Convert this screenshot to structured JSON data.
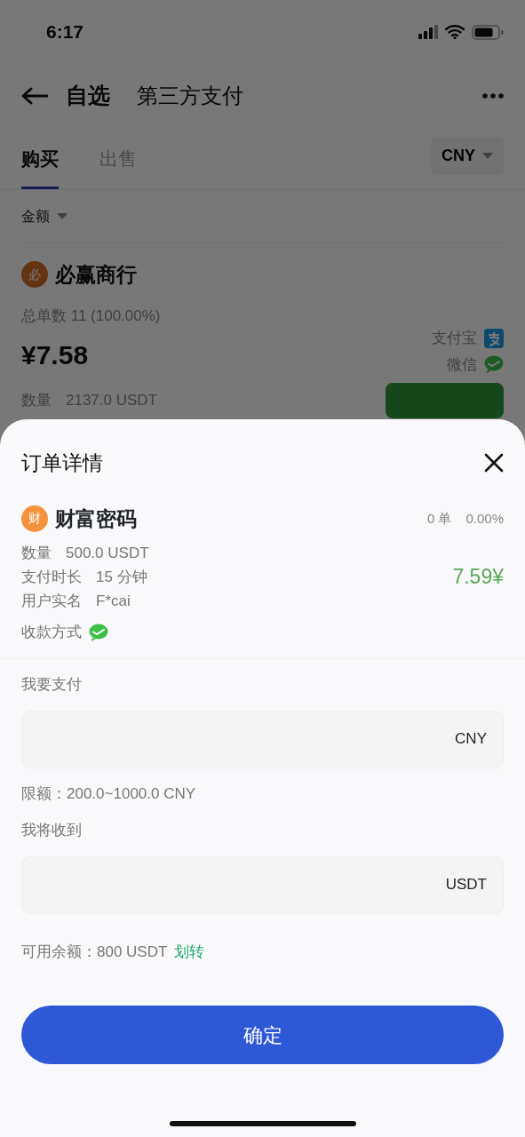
{
  "status_bar": {
    "time": "6:17"
  },
  "header": {
    "title": "自选",
    "subtitle": "第三方支付"
  },
  "tabs": [
    {
      "label": "购买",
      "selected": true
    },
    {
      "label": "出售",
      "selected": false
    }
  ],
  "currency_select": "CNY",
  "filter": "金额",
  "merchant": {
    "avatar": "必",
    "name": "必赢商行",
    "orders": "总单数 11 (100.00%)",
    "price": "¥7.58",
    "payment_methods": [
      {
        "label": "支付宝",
        "kind": "alipay"
      },
      {
        "label": "微信",
        "kind": "wechat"
      }
    ],
    "quantity_label": "数量",
    "quantity": "2137.0 USDT"
  },
  "sheet": {
    "title": "订单详情",
    "seller": {
      "avatar": "财",
      "name": "财富密码",
      "orders": "0 单",
      "rate": "0.00%",
      "price": "7.59¥",
      "details": [
        {
          "label": "数量",
          "value": "500.0 USDT"
        },
        {
          "label": "支付时长",
          "value": "15 分钟"
        },
        {
          "label": "用户实名",
          "value": "F*cai"
        }
      ],
      "payment_label": "收款方式",
      "payment_methods": [
        {
          "kind": "wechat"
        }
      ]
    },
    "pay_field": {
      "label": "我要支付",
      "unit": "CNY"
    },
    "limit": "限额：200.0~1000.0 CNY",
    "receive_field": {
      "label": "我将收到",
      "unit": "USDT"
    },
    "balance": "可用余额：800 USDT",
    "transfer_link": "划转",
    "confirm_button": "确定"
  }
}
